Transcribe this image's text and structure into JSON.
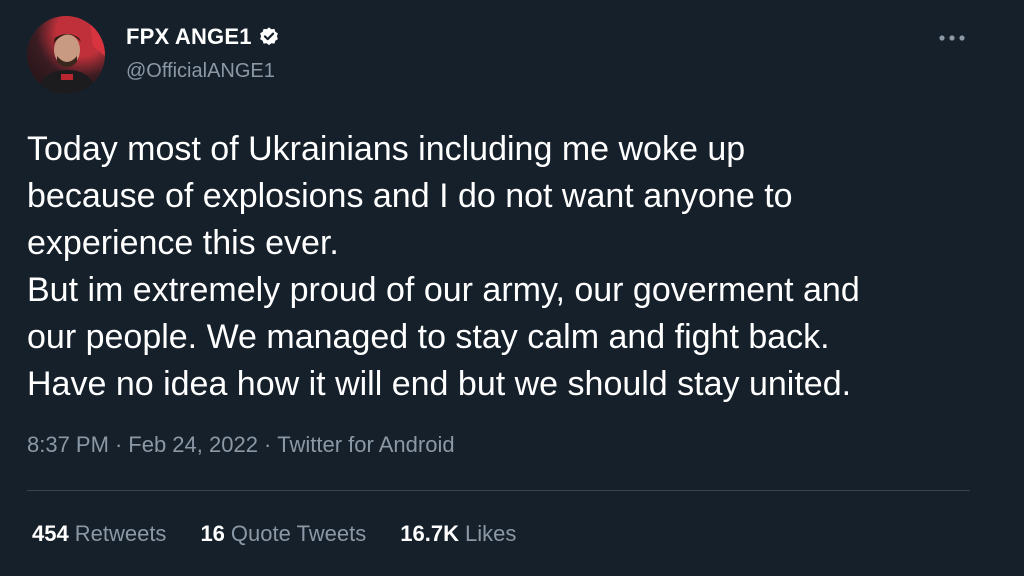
{
  "author": {
    "display_name": "FPX ANGE1",
    "handle": "@OfficialANGE1",
    "verified": true
  },
  "tweet": {
    "text": "Today most of Ukrainians including me woke up\nbecause of explosions and I do not want anyone to\nexperience this ever.\nBut im extremely proud of our army, our goverment and\nour people. We managed to stay calm and fight back.\nHave no idea how it will end but we should stay united.",
    "time": "8:37 PM",
    "separator": "·",
    "date": "Feb 24, 2022",
    "source": "Twitter for Android"
  },
  "stats": {
    "retweets_count": "454",
    "retweets_label": "Retweets",
    "quotes_count": "16",
    "quotes_label": "Quote Tweets",
    "likes_count": "16.7K",
    "likes_label": "Likes"
  },
  "icons": {
    "verified": "verified-badge-icon",
    "more": "more-horizontal-icon"
  },
  "colors": {
    "background": "#15202b",
    "text_primary": "#ffffff",
    "text_secondary": "#8b98a5",
    "divider": "#38444d"
  }
}
